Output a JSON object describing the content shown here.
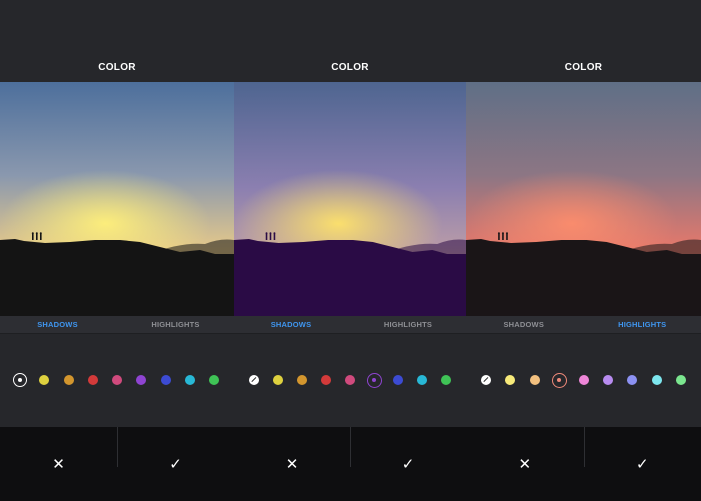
{
  "panels": [
    {
      "title": "COLOR",
      "tabs": {
        "shadows": "SHADOWS",
        "highlights": "HIGHLIGHTS"
      },
      "active_tab": "shadows",
      "tint": "none",
      "swatches": [
        "#ffffff",
        "#ded13f",
        "#d3962e",
        "#d33a3a",
        "#d04a7d",
        "#8f44d2",
        "#3c4bd3",
        "#28b8d6",
        "#3fc356"
      ],
      "selected_swatch": 0,
      "cancel_icon": "✕",
      "confirm_icon": "✓"
    },
    {
      "title": "COLOR",
      "tabs": {
        "shadows": "SHADOWS",
        "highlights": "HIGHLIGHTS"
      },
      "active_tab": "shadows",
      "tint": "shadows-purple",
      "swatches": [
        "#ffffff",
        "#ded13f",
        "#d3962e",
        "#d33a3a",
        "#d04a7d",
        "#8f44d2",
        "#3c4bd3",
        "#28b8d6",
        "#3fc356"
      ],
      "selected_swatch": 5,
      "cancel_icon": "✕",
      "confirm_icon": "✓"
    },
    {
      "title": "COLOR",
      "tabs": {
        "shadows": "SHADOWS",
        "highlights": "HIGHLIGHTS"
      },
      "active_tab": "highlights",
      "tint": "highlights-red",
      "swatches": [
        "#ffffff",
        "#f7ea7a",
        "#f2c07f",
        "#f08a7a",
        "#ee86d8",
        "#b88cf0",
        "#8c91f2",
        "#7de6ee",
        "#7be68f"
      ],
      "selected_swatch": 3,
      "cancel_icon": "✕",
      "confirm_icon": "✓"
    }
  ],
  "icons": {
    "cancel": "close-icon",
    "confirm": "checkmark-icon",
    "none_swatch": "no-color-icon"
  },
  "colors": {
    "background": "#26272b",
    "active_tab": "#3f96f0",
    "inactive_tab": "#8e8f94",
    "action_bar": "#0e0e10"
  }
}
